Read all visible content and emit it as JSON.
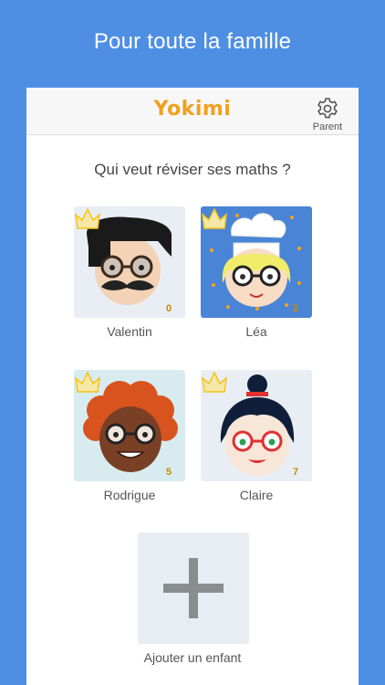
{
  "headline": "Pour toute la famille",
  "app": {
    "logo": "Yokimi",
    "parent_label": "Parent"
  },
  "prompt": "Qui veut réviser ses maths ?",
  "profiles": [
    {
      "name": "Valentin",
      "crowns": "0"
    },
    {
      "name": "Léa",
      "crowns": "2"
    },
    {
      "name": "Rodrigue",
      "crowns": "5"
    },
    {
      "name": "Claire",
      "crowns": "7"
    }
  ],
  "add_child_label": "Ajouter un enfant",
  "colors": {
    "background": "#4f8fe3",
    "logo": "#f2a01c",
    "crown": "#f5c518"
  }
}
